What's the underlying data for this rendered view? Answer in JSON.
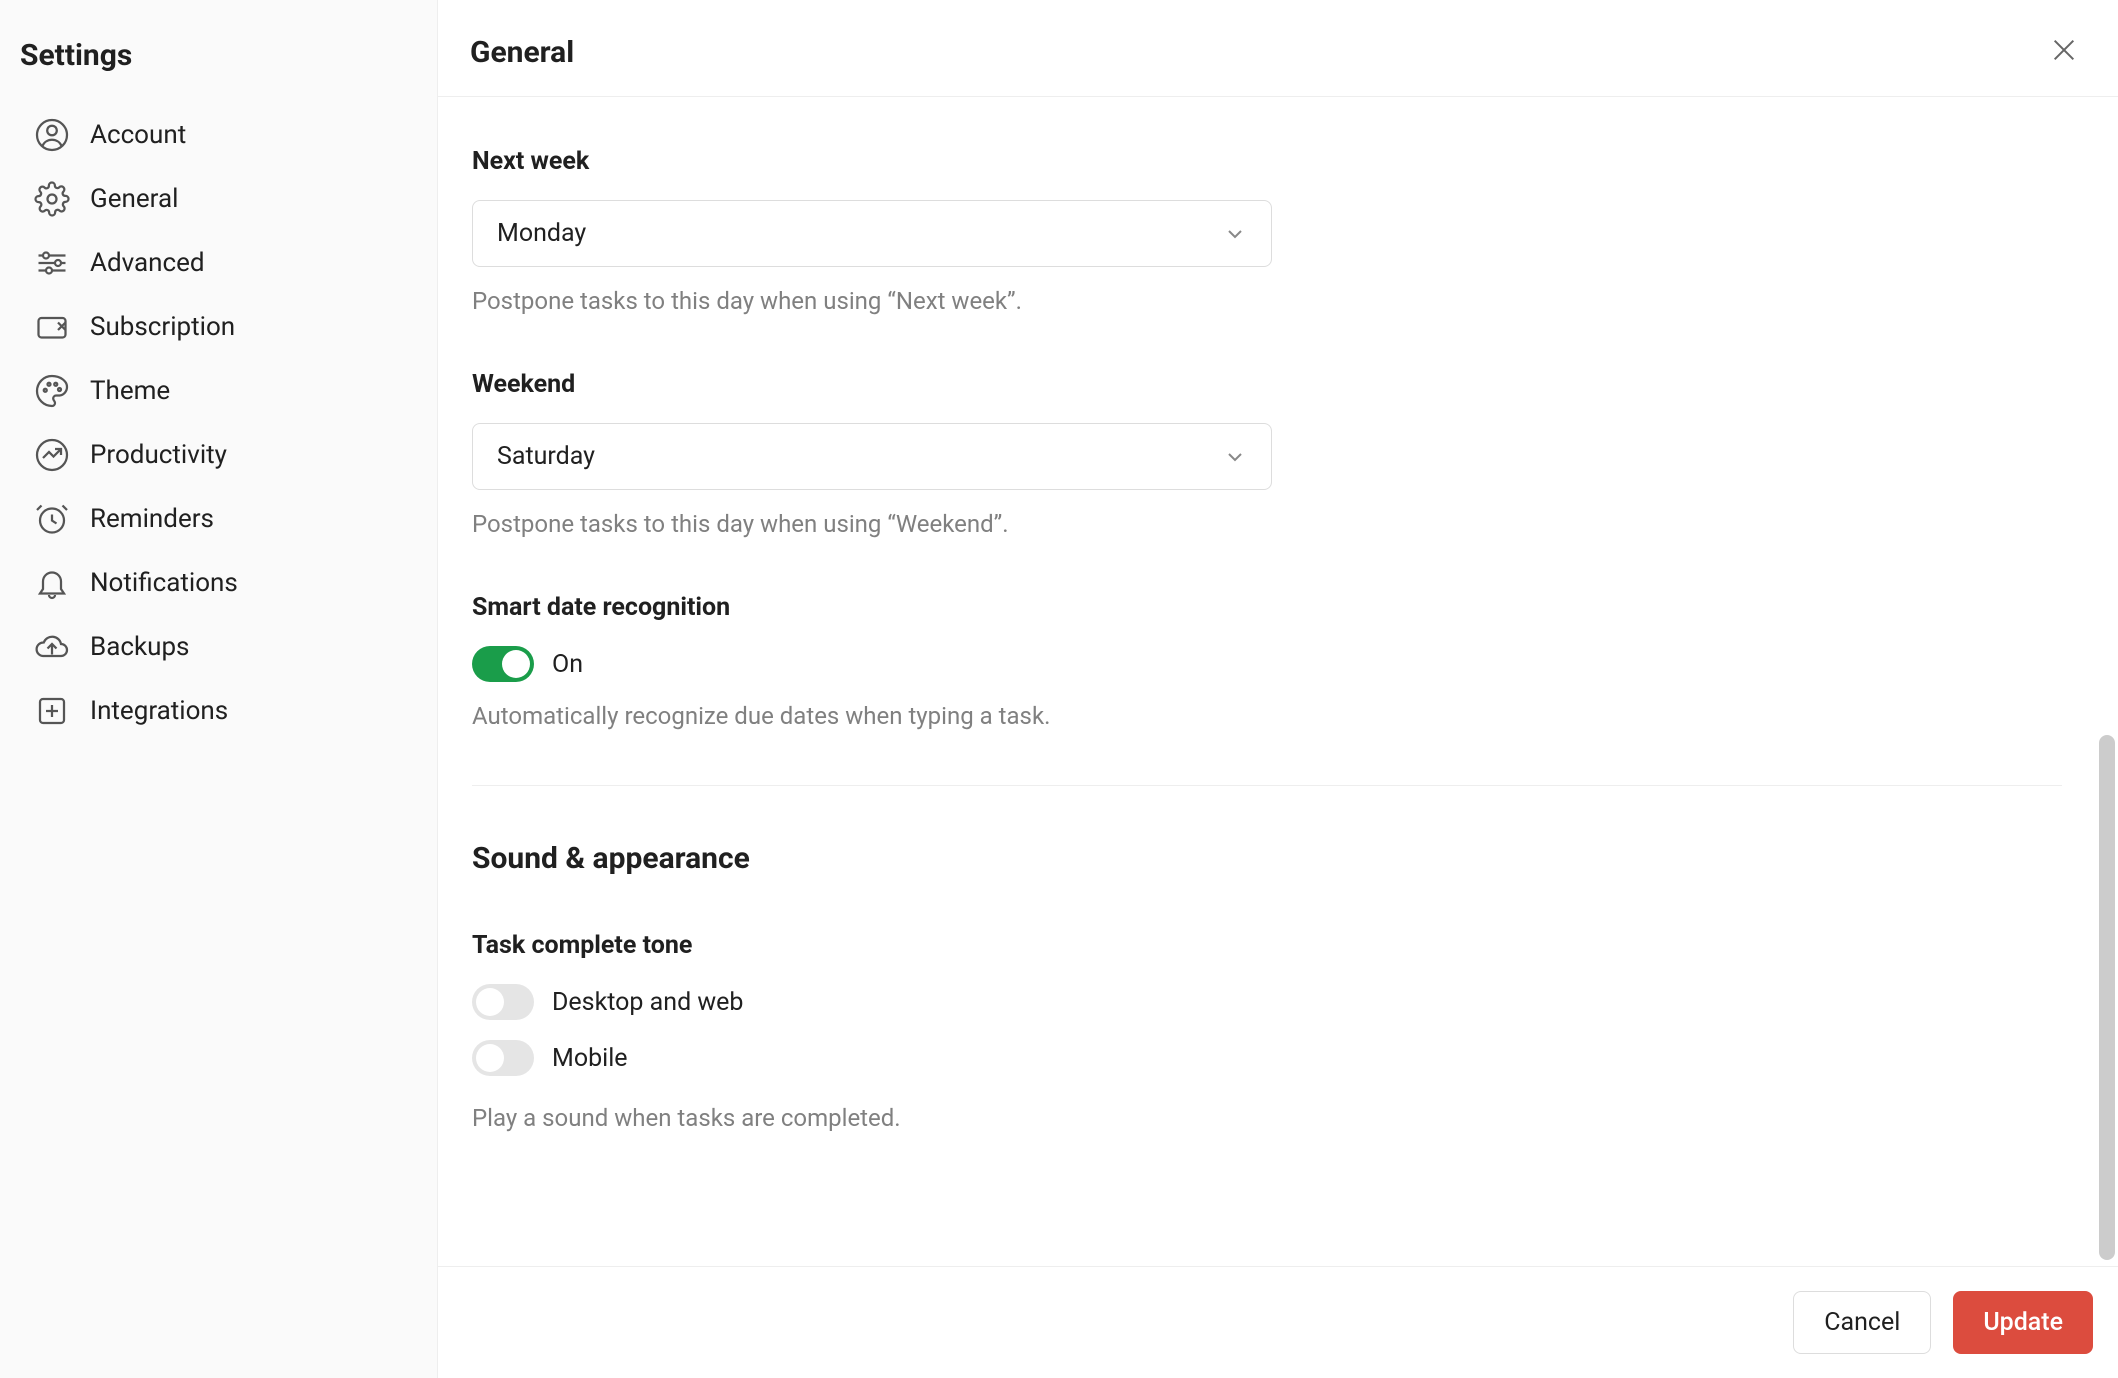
{
  "sidebar": {
    "title": "Settings",
    "items": [
      {
        "label": "Account",
        "icon": "person-icon"
      },
      {
        "label": "General",
        "icon": "gear-icon"
      },
      {
        "label": "Advanced",
        "icon": "sliders-icon"
      },
      {
        "label": "Subscription",
        "icon": "card-icon"
      },
      {
        "label": "Theme",
        "icon": "palette-icon"
      },
      {
        "label": "Productivity",
        "icon": "trend-icon"
      },
      {
        "label": "Reminders",
        "icon": "clock-icon"
      },
      {
        "label": "Notifications",
        "icon": "bell-icon"
      },
      {
        "label": "Backups",
        "icon": "cloud-icon"
      },
      {
        "label": "Integrations",
        "icon": "plus-box-icon"
      }
    ]
  },
  "header": {
    "title": "General"
  },
  "next_week": {
    "label": "Next week",
    "value": "Monday",
    "help": "Postpone tasks to this day when using “Next week”."
  },
  "weekend": {
    "label": "Weekend",
    "value": "Saturday",
    "help": "Postpone tasks to this day when using “Weekend”."
  },
  "smart_date": {
    "label": "Smart date recognition",
    "state_label": "On",
    "on": true,
    "help": "Automatically recognize due dates when typing a task."
  },
  "sound_section": {
    "title": "Sound & appearance"
  },
  "task_complete": {
    "label": "Task complete tone",
    "desktop_label": "Desktop and web",
    "desktop_on": false,
    "mobile_label": "Mobile",
    "mobile_on": false,
    "help": "Play a sound when tasks are completed."
  },
  "footer": {
    "cancel": "Cancel",
    "update": "Update"
  }
}
